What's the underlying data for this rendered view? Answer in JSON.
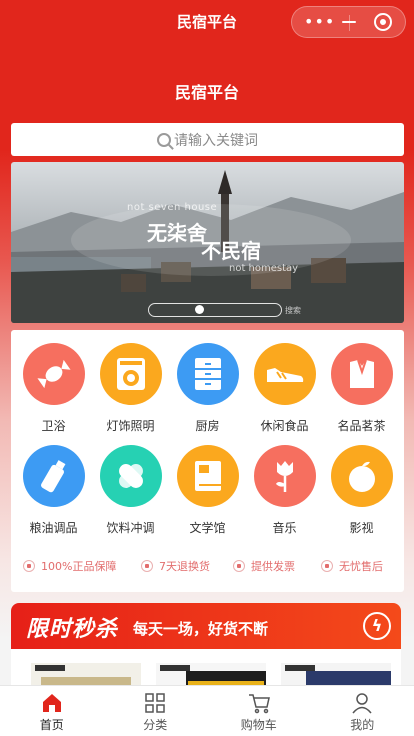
{
  "statusbar": {
    "title": "民宿平台"
  },
  "header": {
    "title": "民宿平台"
  },
  "search": {
    "placeholder": "请输入关键词"
  },
  "banner": {
    "line_small_top": "not seven house",
    "line_big_1": "无柒舍",
    "line_big_2": "不民宿",
    "line_small_bottom": "not homestay",
    "tag": "搜索"
  },
  "categories": [
    {
      "label": "卫浴",
      "icon": "candy-icon",
      "color": "#f66f5f"
    },
    {
      "label": "灯饰照明",
      "icon": "washer-icon",
      "color": "#fba81e"
    },
    {
      "label": "厨房",
      "icon": "cabinet-icon",
      "color": "#3d9bf3"
    },
    {
      "label": "休闲食品",
      "icon": "sneaker-icon",
      "color": "#fba81e"
    },
    {
      "label": "名品茗茶",
      "icon": "shirt-icon",
      "color": "#f66f5f"
    },
    {
      "label": "粮油调品",
      "icon": "bottle-icon",
      "color": "#3d9bf3"
    },
    {
      "label": "饮料冲调",
      "icon": "pill-icon",
      "color": "#26d1b3"
    },
    {
      "label": "文学馆",
      "icon": "book-icon",
      "color": "#fba81e"
    },
    {
      "label": "音乐",
      "icon": "rose-icon",
      "color": "#f66f5f"
    },
    {
      "label": "影视",
      "icon": "apple-icon",
      "color": "#fba81e"
    }
  ],
  "guarantees": [
    "100%正品保障",
    "7天退换货",
    "提供发票",
    "无忧售后"
  ],
  "flash_sale": {
    "title": "限时秒杀",
    "subtitle": "每天一场，好货不断",
    "bolt_icon": "lightning-icon"
  },
  "tabbar": [
    {
      "label": "首页",
      "icon": "home-icon",
      "active": true
    },
    {
      "label": "分类",
      "icon": "grid-icon",
      "active": false
    },
    {
      "label": "购物车",
      "icon": "cart-icon",
      "active": false
    },
    {
      "label": "我的",
      "icon": "user-icon",
      "active": false
    }
  ],
  "colors": {
    "brand_red": "#e1261c",
    "tab_active": "#e1261c"
  }
}
